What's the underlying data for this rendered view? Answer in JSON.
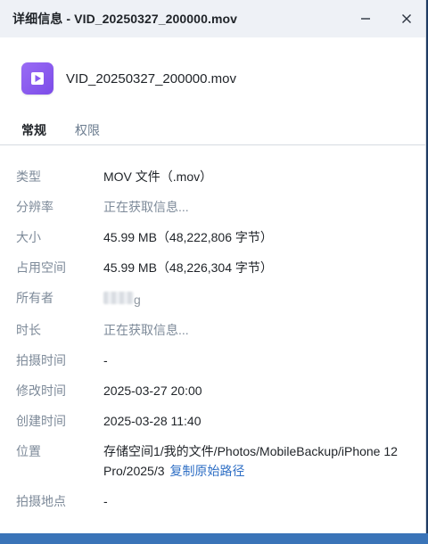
{
  "window": {
    "title": "详细信息 - VID_20250327_200000.mov",
    "minimize_icon": "minimize-icon",
    "close_icon": "close-icon"
  },
  "file": {
    "icon": "video-file-icon",
    "name": "VID_20250327_200000.mov",
    "icon_color": "#8a5cf0"
  },
  "tabs": [
    {
      "label": "常规",
      "active": true
    },
    {
      "label": "权限",
      "active": false
    }
  ],
  "properties": {
    "type": {
      "label": "类型",
      "value": "MOV 文件（.mov）"
    },
    "resolution": {
      "label": "分辨率",
      "value": "正在获取信息..."
    },
    "size": {
      "label": "大小",
      "value": "45.99 MB（48,222,806 字节）"
    },
    "disk_usage": {
      "label": "占用空间",
      "value": "45.99 MB（48,226,304 字节）"
    },
    "owner": {
      "label": "所有者",
      "value": "g"
    },
    "duration": {
      "label": "时长",
      "value": "正在获取信息..."
    },
    "capture_time": {
      "label": "拍摄时间",
      "value": "-"
    },
    "modified": {
      "label": "修改时间",
      "value": "2025-03-27 20:00"
    },
    "created": {
      "label": "创建时间",
      "value": "2025-03-28 11:40"
    },
    "location": {
      "label": "位置",
      "value": "存储空间1/我的文件/Photos/MobileBackup/iPhone 12 Pro/2025/3",
      "copy_label": "复制原始路径"
    },
    "capture_location": {
      "label": "拍摄地点",
      "value": "-"
    }
  },
  "colors": {
    "link": "#2f6fc5",
    "muted": "#7d8a99",
    "titlebar": "#eef1f6"
  }
}
